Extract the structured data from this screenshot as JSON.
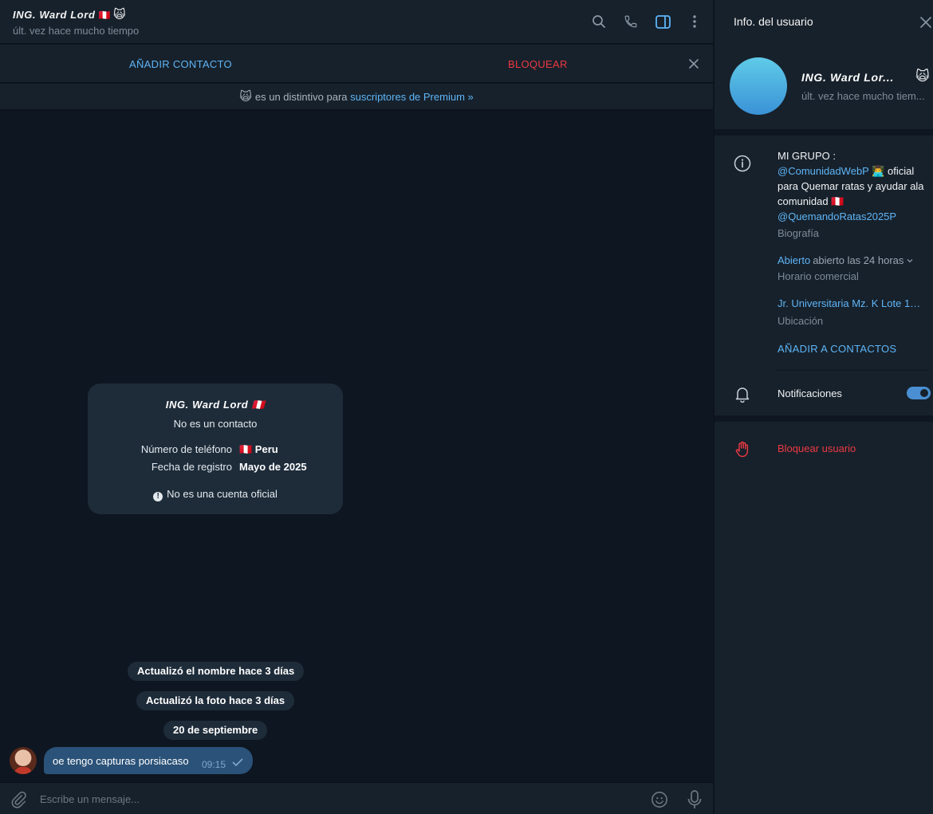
{
  "colors": {
    "accent": "#5eb5f7",
    "danger": "#ec3942",
    "bubble": "#2b5278",
    "panel": "#17212b",
    "background": "#0e1621"
  },
  "header": {
    "peer_name": "ING. Ward Lord",
    "flag": "🇵🇪",
    "premium_badge": "🙀",
    "status": "últ. vez hace mucho tiempo",
    "icons": [
      "search-icon",
      "phone-icon",
      "sidebar-toggle-icon",
      "more-vert-icon"
    ]
  },
  "action_bar": {
    "add_contact": "AÑADIR CONTACTO",
    "block": "BLOQUEAR"
  },
  "premium_notice": {
    "emoji": "🙀",
    "text": "es un distintivo para",
    "link": "suscriptores de Premium »"
  },
  "info_card": {
    "name": "ING. Ward Lord 🇵🇪",
    "subtitle": "No es un contacto",
    "phone_label": "Número de teléfono",
    "phone_value": "🇵🇪  Peru",
    "registered_label": "Fecha de registro",
    "registered_value": "Mayo de 2025",
    "note": "No es una cuenta oficial"
  },
  "service_messages": [
    "Actualizó el nombre hace 3 días",
    "Actualizó la foto hace 3 días",
    "20 de septiembre"
  ],
  "message": {
    "text": "oe tengo capturas porsiacaso",
    "time": "09:15"
  },
  "composer": {
    "placeholder": "Escribe un mensaje..."
  },
  "panel": {
    "title": "Info. del usuario",
    "name": "ING. Ward Lor...",
    "badge": "🙀",
    "status": "últ. vez hace mucho tiem...",
    "bio": {
      "line1": "MI GRUPO :",
      "handle1": "@ComunidadWebP",
      "emoji": "👨‍💻",
      "after_handle": " oficial para Quemar ratas y ayudar ala comunidad ",
      "flag": "🇵🇪",
      "handle2": "@QuemandoRatas2025P",
      "label": "Biografía"
    },
    "hours": {
      "open": "Abierto",
      "detail": "abierto las 24 horas",
      "label": "Horario comercial"
    },
    "location": {
      "value": "Jr. Universitaria Mz. K Lote 13 ...",
      "label": "Ubicación"
    },
    "add_to_contacts": "AÑADIR A CONTACTOS",
    "notifications": {
      "label": "Notificaciones",
      "enabled": true
    },
    "block_user": "Bloquear usuario"
  }
}
